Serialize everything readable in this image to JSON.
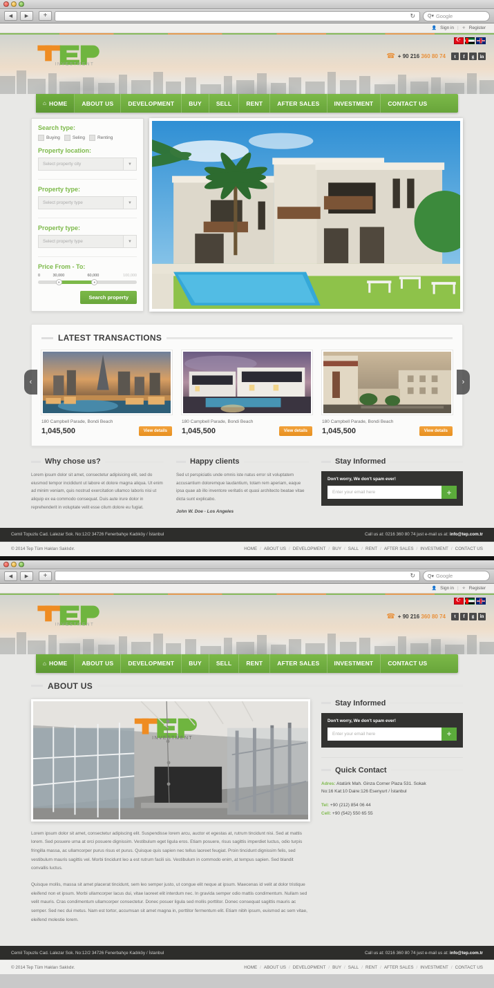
{
  "browser": {
    "url_value": "",
    "url_placeholder": "",
    "reload_icon": "reload-icon",
    "search_placeholder": "Google",
    "search_prefix": "Q",
    "back_icon": "back-arrow-icon",
    "forward_icon": "forward-arrow-icon",
    "add_tab_icon": "plus-icon"
  },
  "utility": {
    "sign_in": "Sign in",
    "separator": "|",
    "register": "Register",
    "person_icon": "person-icon",
    "key_icon": "key-icon"
  },
  "brand": {
    "name": "TEP",
    "tagline": "INVESTMENT",
    "orange": "#ef8c22",
    "green": "#6fb53f"
  },
  "header": {
    "flags": [
      "flag-turkey",
      "flag-uae",
      "flag-uk"
    ],
    "phone_icon": "phone-icon",
    "phone_prefix": "+ 90 216",
    "phone_number": "360 80 74",
    "social": [
      {
        "name": "twitter-icon",
        "glyph": "t"
      },
      {
        "name": "facebook-icon",
        "glyph": "f"
      },
      {
        "name": "google-plus-icon",
        "glyph": "g"
      },
      {
        "name": "linkedin-icon",
        "glyph": "in"
      }
    ]
  },
  "nav": {
    "home_icon": "home-icon",
    "items": [
      {
        "label": "HOME",
        "active": true
      },
      {
        "label": "ABOUT US",
        "active": false
      },
      {
        "label": "DEVELOPMENT",
        "active": false
      },
      {
        "label": "BUY",
        "active": false
      },
      {
        "label": "SELL",
        "active": false
      },
      {
        "label": "RENT",
        "active": false
      },
      {
        "label": "AFTER SALES",
        "active": false
      },
      {
        "label": "INVESTMENT",
        "active": false
      },
      {
        "label": "CONTACT US",
        "active": false
      }
    ]
  },
  "search_panel": {
    "search_type_label": "Search type:",
    "checkboxes": [
      {
        "label": "Buying",
        "checked": false
      },
      {
        "label": "Seling",
        "checked": false
      },
      {
        "label": "Renting",
        "checked": false
      }
    ],
    "location_label": "Property location:",
    "location_placeholder": "Select property city",
    "type_label_1": "Property type:",
    "type_placeholder_1": "Select property type",
    "type_label_2": "Property type:",
    "type_placeholder_2": "Select property type",
    "price_label": "Price From - To:",
    "price_ticks": [
      "0",
      "30,000",
      "60,000",
      "100,000"
    ],
    "price_min": 30000,
    "price_max": 60000,
    "range_start": 0,
    "range_end": 100000,
    "search_button": "Search property",
    "caret_icon": "chevron-down-icon"
  },
  "latest": {
    "title": "LATEST TRANSACTIONS",
    "prev_icon": "chevron-left-icon",
    "next_icon": "chevron-right-icon",
    "cards": [
      {
        "address": "180 Campbell Parade, Bondi Beach",
        "price": "1,045,500",
        "button": "View details",
        "image": "dubai-downtown-skyline"
      },
      {
        "address": "180 Campbell Parade, Bondi Beach",
        "price": "1,045,500",
        "button": "View details",
        "image": "modern-villa-pool-dusk"
      },
      {
        "address": "180 Campbell Parade, Bondi Beach",
        "price": "1,045,500",
        "button": "View details",
        "image": "arabic-residential-quarter"
      }
    ]
  },
  "why": {
    "title": "Why chose us?",
    "body": "Lorem ipsum dolor sit amet, consectetur adipisicing elit, sed do eiusmod tempor incididunt ut labore et dolore magna aliqua. Ut enim ad minim veniam, quis nostrud exercitation ullamco laboris nisi ut aliquip ex ea commodo consequat. Duis aute irure dolor in reprehenderit in voluptate velit esse cilum dolore eu fugiat."
  },
  "happy": {
    "title": "Happy clients",
    "body": "Sed ut perspiciatis unde omnis iste natus error sit voluptatem accusantium doloremque laudantium, totam rem aperiam, eaque ipsa quae ab illo inventore veritatis et quasi architecto beatae vitae dicta sunt explicabo.",
    "attribution": "John W. Doe - Los Angeles"
  },
  "newsletter": {
    "title": "Stay Informed",
    "note": "Don't worry, We don't spam ever!",
    "placeholder": "Enter your email here",
    "value": "",
    "submit_icon": "plus-icon"
  },
  "footer": {
    "address": "Cemil Topuzlu Cad. Lalezar Sok. No:12/2 34726 Fenerbahçe Kadıköy / İstanbul",
    "call_prefix": "Call us at: 0216 360 80 74 just e-mail us at:",
    "email": "info@tep.com.tr",
    "copyright": "© 2014 Tep Tüm Hakları Saklıdır.",
    "links": [
      "HOME",
      "ABOUT US",
      "DEVELOPMENT",
      "BUY",
      "SALL",
      "RENT",
      "AFTER SALES",
      "INVESTMENT",
      "CONTACT US"
    ]
  },
  "about": {
    "title": "ABOUT US",
    "image": "tep-investment-office-interior",
    "paragraphs": [
      "Lorem ipsum dolor sit amet, consectetur adipiscing elit. Suspendisse lorem arcu, auctor et egestas at, rutrum tincidunt nisi. Sed at mattis lorem. Sed posuere urna at orci posuere dignissim. Vestibulum eget ligula eros. Etiam posuere, risus sagittis imperdiet luctus, odio turpis fringilla massa, ac ullamcorper purus risus et purus. Quisque quis sapien nec tellus laoreet feugiat. Proin tincidunt dignissim felis, sed vestibulum mauris sagittis vel. Morbi tincidunt leo a est rutrum facili sis. Vestibulum in commodo enim, at tempus sapien. Sed blandit convallis luctus.",
      "Quisque mollis, massa sit amet placerat tincidunt, sem leo semper justo, ut congue elit neque at ipsum. Maecenas id velit at dolor tristique eleifend non et ipsum. Morbi ullamcorper lacus dui, vitae laoreet elit interdum nec. In gravida semper odio mattis condimentum. Nullam sed velit mauris. Cras condimentum ullamcorper consectetur. Donec posuer ligula sed mollis porttitor. Donec consequat sagittis mauris ac semper. Sed nec dui metus. Nam est tortor, accumsan sit amet magna in, porttitor fermentum elit. Etiam nibh ipsum, euismod ac sem vitae, eleifend molestie lorem."
    ]
  },
  "quick_contact": {
    "title": "Quick Contact",
    "address_label": "Adres:",
    "address_line1": "Atatürk Mah. Ginza Corner Plaza 531. Sokak",
    "address_line2": "No:16 Kat:10 Daire:126 Esenyurt / İstanbul",
    "tel_label": "Tel:",
    "tel_value": "+90 (212) 854 06 44",
    "cell_label": "Cell:",
    "cell_value": "+90 (542) 550 65 55"
  }
}
